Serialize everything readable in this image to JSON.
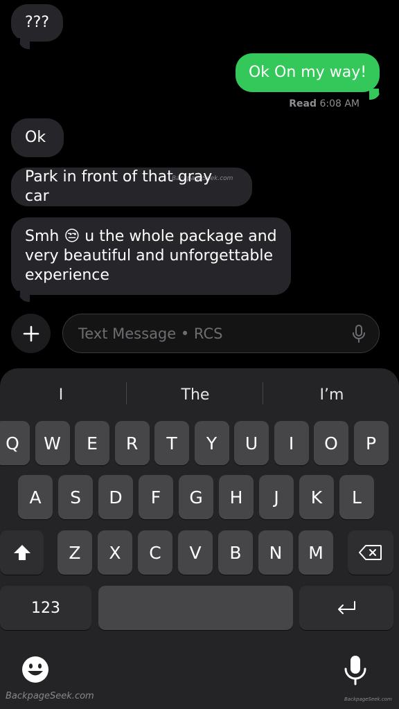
{
  "messages": {
    "m1": "???",
    "m2": "Ok On my way!",
    "read_label": "Read",
    "read_time": "6:08 AM",
    "m3": "Ok",
    "m4": "Park in front of that gray car",
    "m5_before": "Smh",
    "m5_emoji": "😒",
    "m5_after": "u the whole package and",
    "m5_line2": "very beautiful and unforgettable",
    "m5_line3": "experience"
  },
  "watermarks": {
    "center": "BackpageSeek.com",
    "bottom_left": "BackpageSeek.com",
    "bottom_right": "BackpageSeek.com"
  },
  "compose": {
    "placeholder": "Text Message • RCS",
    "plus_icon": "plus-icon",
    "mic_icon": "microphone-icon"
  },
  "keyboard": {
    "suggestions": [
      "I",
      "The",
      "I’m"
    ],
    "row1": [
      "Q",
      "W",
      "E",
      "R",
      "T",
      "Y",
      "U",
      "I",
      "O",
      "P"
    ],
    "row2": [
      "A",
      "S",
      "D",
      "F",
      "G",
      "H",
      "J",
      "K",
      "L"
    ],
    "row3": [
      "Z",
      "X",
      "C",
      "V",
      "B",
      "N",
      "M"
    ],
    "numbers_label": "123",
    "shift_icon": "shift-icon",
    "delete_icon": "delete-icon",
    "return_icon": "return-icon",
    "emoji_icon": "emoji-icon",
    "dictation_icon": "microphone-icon"
  },
  "colors": {
    "outgoing_bubble": "#34c759",
    "incoming_bubble": "#26252a",
    "keyboard_bg": "#242427",
    "key_bg": "#464649"
  }
}
